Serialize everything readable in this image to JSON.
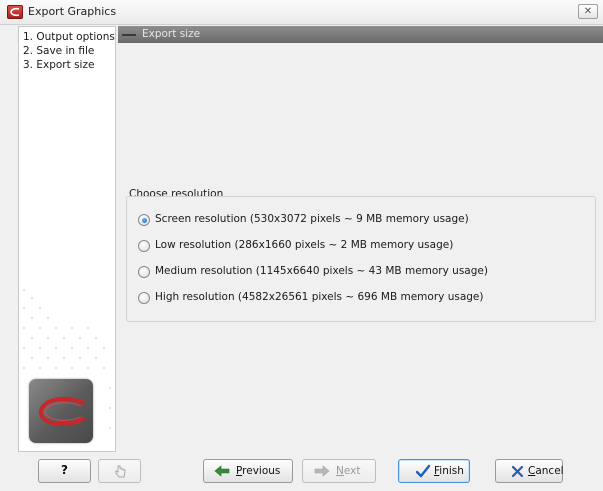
{
  "window": {
    "title": "Export Graphics",
    "close_glyph": "✕"
  },
  "steps": [
    "1. Output options",
    "2. Save in file",
    "3. Export size"
  ],
  "section": {
    "title": "Export size"
  },
  "resolution": {
    "group_label": "Choose resolution",
    "options": [
      {
        "label": "Screen resolution (530x3072 pixels ~ 9 MB memory usage)",
        "selected": true
      },
      {
        "label": "Low resolution (286x1660 pixels ~ 2 MB memory usage)",
        "selected": false
      },
      {
        "label": "Medium resolution (1145x6640 pixels ~ 43 MB memory usage)",
        "selected": false
      },
      {
        "label": "High resolution (4582x26561 pixels ~ 696 MB memory usage)",
        "selected": false
      }
    ]
  },
  "buttons": {
    "help": "?",
    "previous": {
      "mnemonic": "P",
      "rest": "revious"
    },
    "next": {
      "mnemonic": "N",
      "rest": "ext"
    },
    "finish": {
      "mnemonic": "F",
      "rest": "inish"
    },
    "cancel": {
      "mnemonic": "C",
      "rest": "ancel"
    }
  },
  "icons": {
    "app": "app-logo-icon",
    "help": "question-icon",
    "misc": "pointer-hand-icon",
    "previous": "arrow-left-icon",
    "next": "arrow-right-icon",
    "finish": "checkmark-icon",
    "cancel": "x-icon"
  },
  "colors": {
    "accent": "#1c5fbd",
    "header_bar": "#7a7a7a",
    "logo_swoosh": "#c8262a"
  }
}
